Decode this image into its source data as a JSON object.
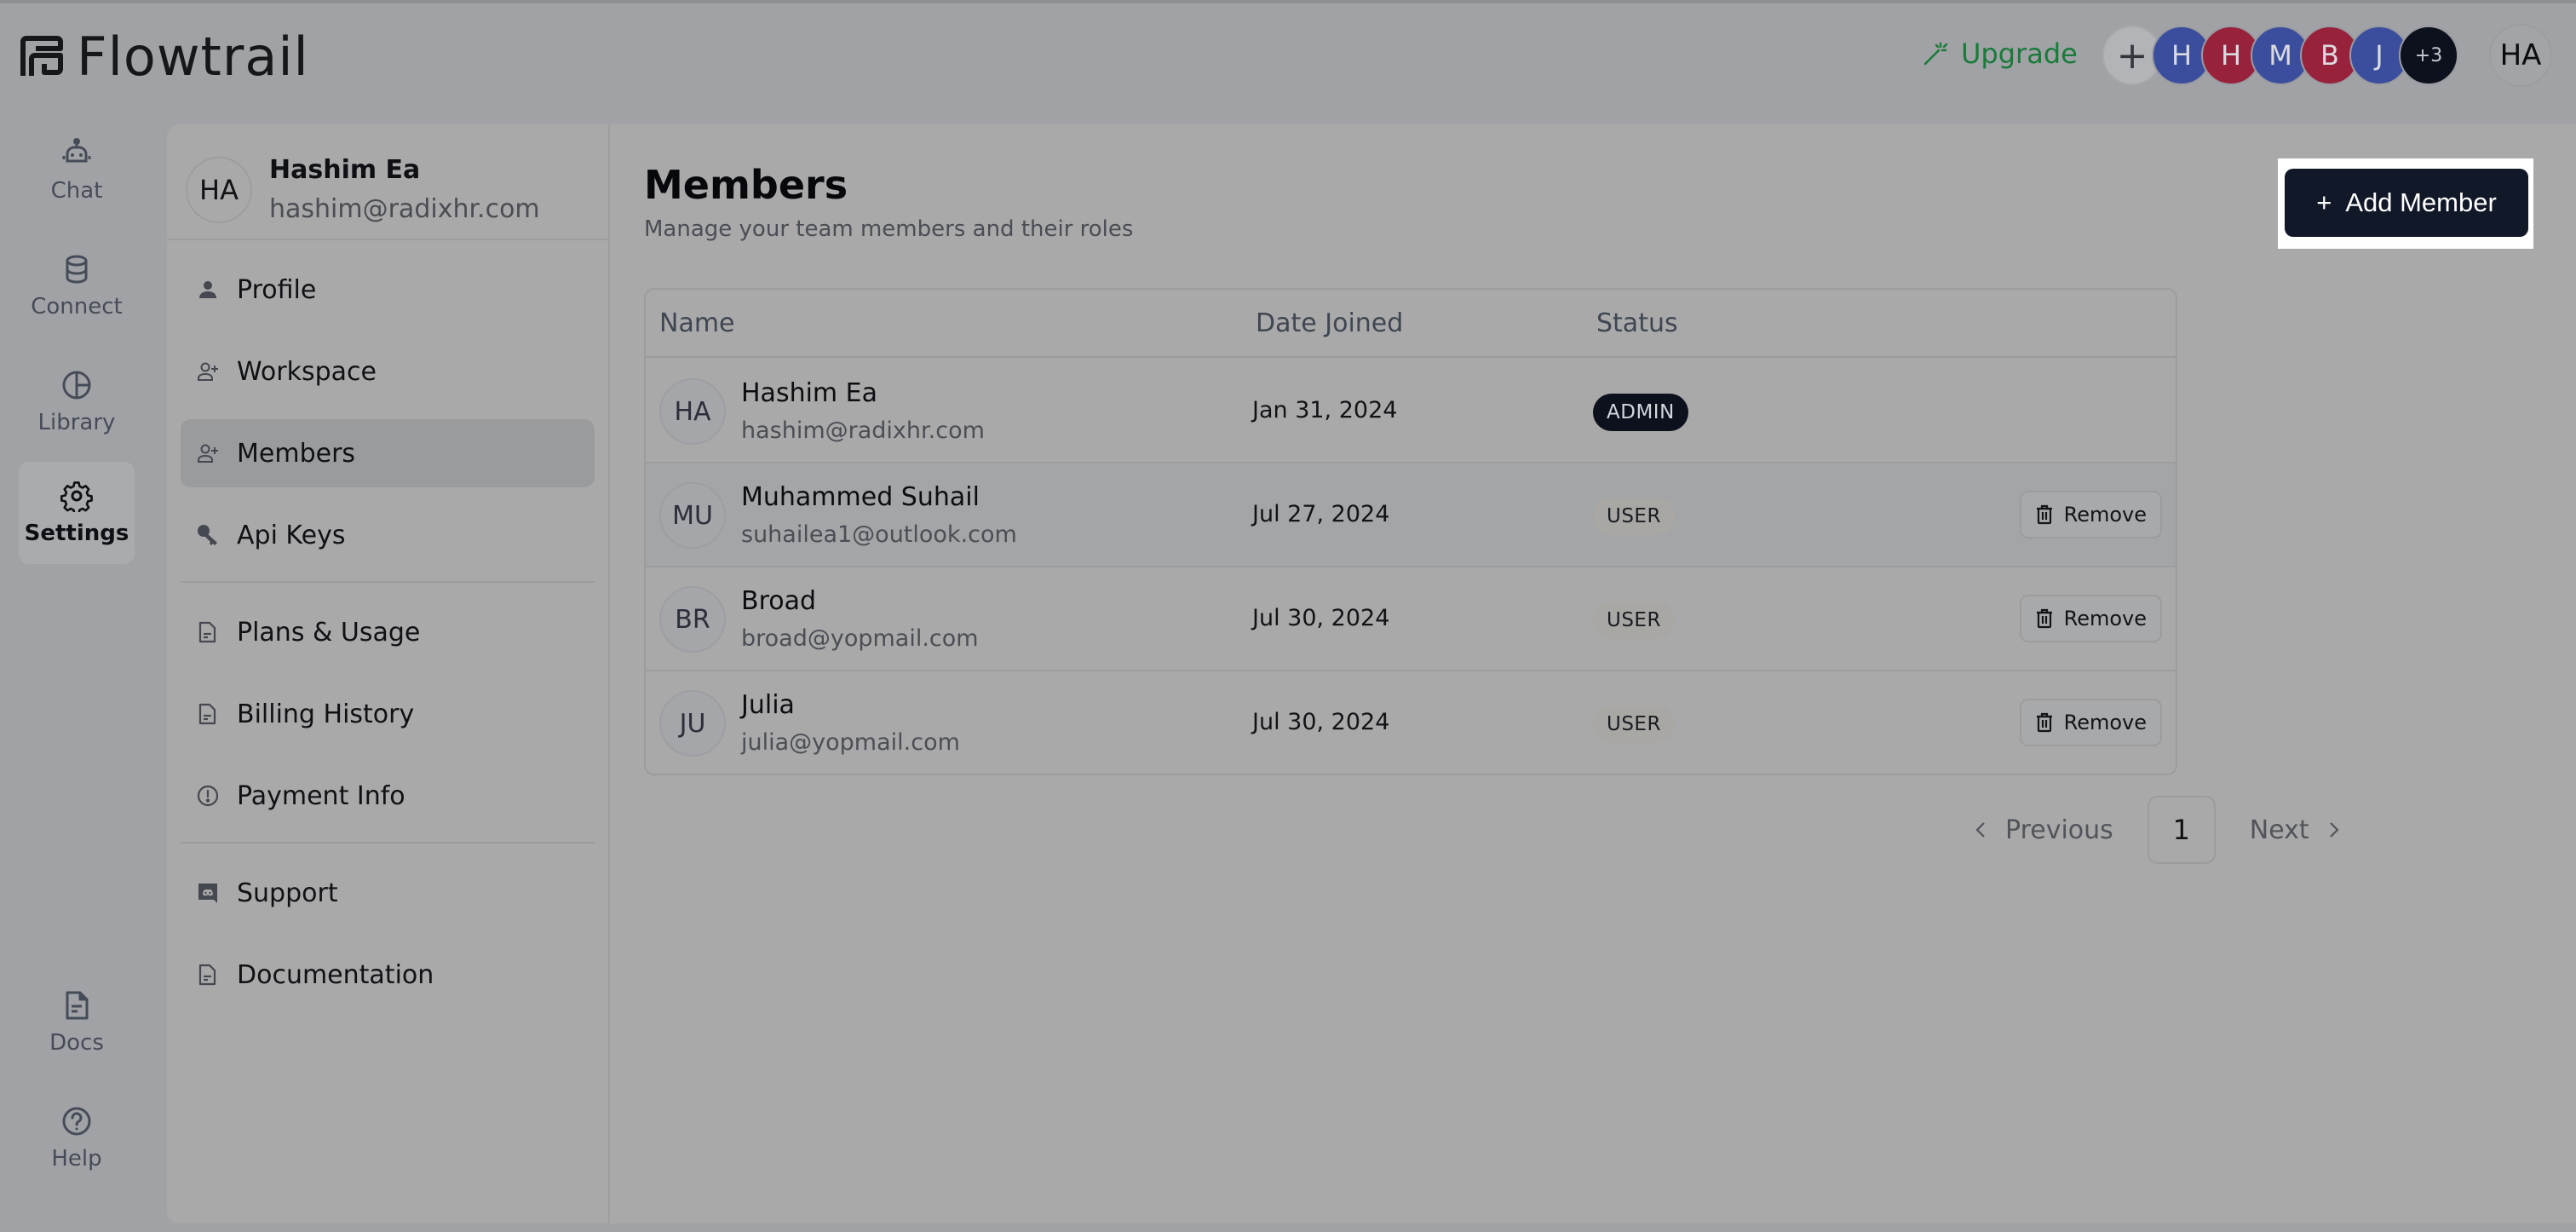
{
  "app": {
    "name": "Flowtrail"
  },
  "header": {
    "upgrade_label": "Upgrade",
    "add_collaborator_symbol": "+",
    "collaborators": [
      {
        "initial": "H",
        "color": "blue"
      },
      {
        "initial": "H",
        "color": "red"
      },
      {
        "initial": "M",
        "color": "blue"
      },
      {
        "initial": "B",
        "color": "red"
      },
      {
        "initial": "J",
        "color": "blue"
      }
    ],
    "more_count": "+3",
    "user_initials": "HA"
  },
  "rail": {
    "items": [
      {
        "label": "Chat",
        "icon": "robot-icon"
      },
      {
        "label": "Connect",
        "icon": "database-icon"
      },
      {
        "label": "Library",
        "icon": "pie-chart-icon"
      },
      {
        "label": "Settings",
        "icon": "gear-icon",
        "active": true
      }
    ],
    "bottom": [
      {
        "label": "Docs",
        "icon": "document-icon"
      },
      {
        "label": "Help",
        "icon": "help-circle-icon"
      }
    ]
  },
  "settings_nav": {
    "profile": {
      "initials": "HA",
      "name": "Hashim Ea",
      "email": "hashim@radixhr.com"
    },
    "items": [
      {
        "label": "Profile",
        "icon": "person-icon"
      },
      {
        "label": "Workspace",
        "icon": "user-plus-icon"
      },
      {
        "label": "Members",
        "icon": "user-plus-icon",
        "active": true
      },
      {
        "label": "Api Keys",
        "icon": "key-icon"
      },
      {
        "label": "Plans & Usage",
        "icon": "document-icon"
      },
      {
        "label": "Billing History",
        "icon": "document-icon"
      },
      {
        "label": "Payment Info",
        "icon": "alert-circle-icon"
      },
      {
        "label": "Support",
        "icon": "discord-icon"
      },
      {
        "label": "Documentation",
        "icon": "document-icon"
      }
    ]
  },
  "main": {
    "title": "Members",
    "subtitle": "Manage your team members and their roles",
    "add_member_label": "Add Member",
    "add_member_symbol": "+",
    "table": {
      "columns": [
        "Name",
        "Date Joined",
        "Status"
      ],
      "rows": [
        {
          "initials": "HA",
          "name": "Hashim Ea",
          "email": "hashim@radixhr.com",
          "date_joined": "Jan 31, 2024",
          "status": "ADMIN",
          "removable": false
        },
        {
          "initials": "MU",
          "name": "Muhammed Suhail",
          "email": "suhailea1@outlook.com",
          "date_joined": "Jul 27, 2024",
          "status": "USER",
          "removable": true
        },
        {
          "initials": "BR",
          "name": "Broad",
          "email": "broad@yopmail.com",
          "date_joined": "Jul 30, 2024",
          "status": "USER",
          "removable": true
        },
        {
          "initials": "JU",
          "name": "Julia",
          "email": "julia@yopmail.com",
          "date_joined": "Jul 30, 2024",
          "status": "USER",
          "removable": true
        }
      ],
      "remove_label": "Remove"
    },
    "pagination": {
      "previous_label": "Previous",
      "next_label": "Next",
      "current_page": "1"
    }
  },
  "colors": {
    "primary_dark": "#111827",
    "upgrade_green": "#1a7a3a",
    "avatar_blue": "#3b4e9e",
    "avatar_red": "#98223c",
    "overlay_bg": "#a1a2a6"
  }
}
